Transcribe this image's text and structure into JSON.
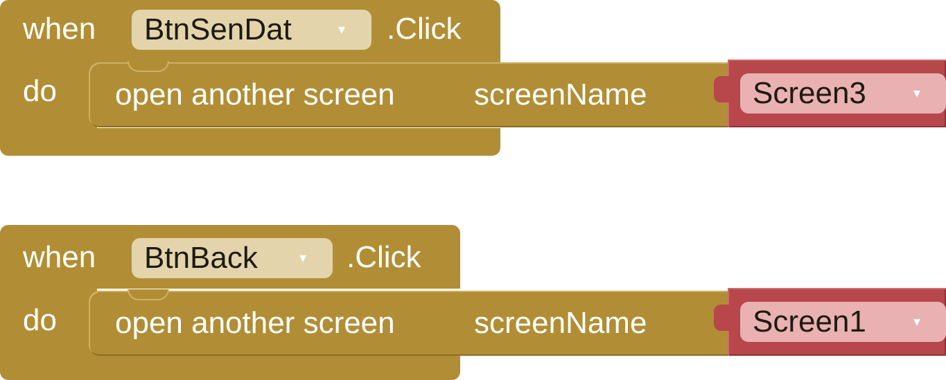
{
  "blocks": [
    {
      "when_label": "when",
      "component": "BtnSenDat",
      "event": ".Click",
      "do_label": "do",
      "statement": "open another screen",
      "param_label": "screenName",
      "screen_value": "Screen3",
      "dropdown_arrow": "▾"
    },
    {
      "when_label": "when",
      "component": "BtnBack",
      "event": ".Click",
      "do_label": "do",
      "statement": "open another screen",
      "param_label": "screenName",
      "screen_value": "Screen1",
      "dropdown_arrow": "▾"
    }
  ],
  "colors": {
    "event_block": "#b18e35",
    "component_field": "#e3d4ac",
    "text_block": "#b7474a",
    "text_field": "#e9b1b2"
  }
}
